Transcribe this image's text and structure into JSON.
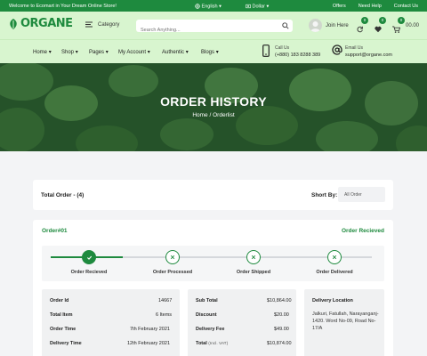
{
  "topbar": {
    "welcome": "Welcome to Ecomart in Your Dream Online Store!",
    "language": "English",
    "currency": "Dollar",
    "links": [
      "Offers",
      "Need Help",
      "Contact Us"
    ]
  },
  "header": {
    "logo": "ORGANE",
    "category_label": "Category",
    "search_placeholder": "Search Anything...",
    "join_label": "Join Here",
    "compare_count": "0",
    "wishlist_count": "0",
    "cart_count": "0",
    "cart_total": "00.00"
  },
  "nav": {
    "items": [
      "Home",
      "Shop",
      "Pages",
      "My Account",
      "Authentic",
      "Blogs"
    ],
    "call_label": "Call Us",
    "call_value": "(+880) 183 8288 389",
    "email_label": "Email Us",
    "email_value": "support@organe.com"
  },
  "hero": {
    "title": "ORDER HISTORY",
    "crumb_home": "Home",
    "crumb_sep": "/",
    "crumb_current": "Orderlist"
  },
  "totalbar": {
    "total_text": "Total Order - (4)",
    "short_by_label": "Short By:",
    "select_value": "All Order"
  },
  "order": {
    "number": "Order#01",
    "status": "Order Recieved",
    "steps": [
      {
        "label": "Order Recieved",
        "done": true
      },
      {
        "label": "Order Processed",
        "done": false
      },
      {
        "label": "Order Shipped",
        "done": false
      },
      {
        "label": "Order Delivered",
        "done": false
      }
    ],
    "info": [
      {
        "k": "Order Id",
        "v": "14667"
      },
      {
        "k": "Total Item",
        "v": "6 Items"
      },
      {
        "k": "Order Time",
        "v": "7th February 2021"
      },
      {
        "k": "Delivery Time",
        "v": "12th February 2021"
      }
    ],
    "totals": [
      {
        "k": "Sub Total",
        "v": "$10,864.00",
        "sub": ""
      },
      {
        "k": "Discount",
        "v": "$20.00",
        "sub": ""
      },
      {
        "k": "Delivery Fee",
        "v": "$49.00",
        "sub": ""
      },
      {
        "k": "Total",
        "v": "$10,874.00",
        "sub": "(Incl. VAT)"
      }
    ],
    "delivery_title": "Delivery Location",
    "delivery_address": "Jalkuri, Fatullah, Narayanganj-1420. Word No-09, Road No-17/A"
  },
  "colors": {
    "brand": "#1e8a3e",
    "header_bg": "#d8f5cf"
  }
}
